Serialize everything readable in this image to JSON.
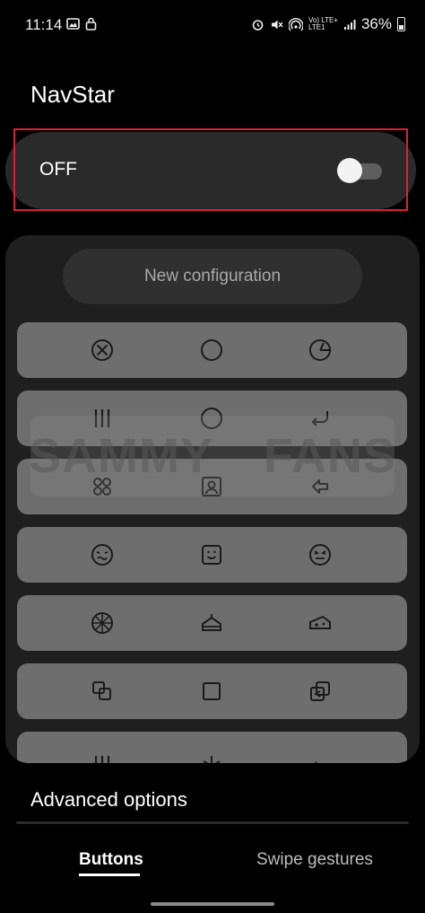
{
  "status_bar": {
    "time": "11:14",
    "left_icons": [
      "gallery-icon",
      "lock-icon"
    ],
    "right_icons": [
      "alarm-icon",
      "mute-icon",
      "hotspot-icon",
      "signal-icon"
    ],
    "network_line1": "Vo) LTE+",
    "network_line2": "LTE1",
    "battery": "36%"
  },
  "app": {
    "title": "NavStar"
  },
  "master_switch": {
    "label": "OFF",
    "state": "off"
  },
  "config": {
    "new_label": "New configuration",
    "presets": [
      [
        "x-circle-icon",
        "circle-icon",
        "pie-circle-icon"
      ],
      [
        "recents-lines-icon",
        "circle-icon",
        "back-curve-arrow-icon"
      ],
      [
        "four-dots-icon",
        "portrait-frame-icon",
        "back-outline-arrow-icon"
      ],
      [
        "face-wink-icon",
        "face-square-icon",
        "face-squint-icon"
      ],
      [
        "pizza-icon",
        "cake-icon",
        "cheese-icon"
      ],
      [
        "overlap-squares-icon",
        "square-icon",
        "switch-window-icon"
      ],
      [
        "recents-lines-icon",
        "asterisk-icon",
        "left-arrow-icon"
      ]
    ]
  },
  "watermark": {
    "left": "SAMMY",
    "right": "FANS"
  },
  "advanced": {
    "title": "Advanced options"
  },
  "tabs": [
    {
      "label": "Buttons",
      "active": true
    },
    {
      "label": "Swipe gestures",
      "active": false
    }
  ],
  "colors": {
    "highlight": "#d8203a",
    "preset_row": "#6e6e6e",
    "panel": "#1f1f1f"
  }
}
